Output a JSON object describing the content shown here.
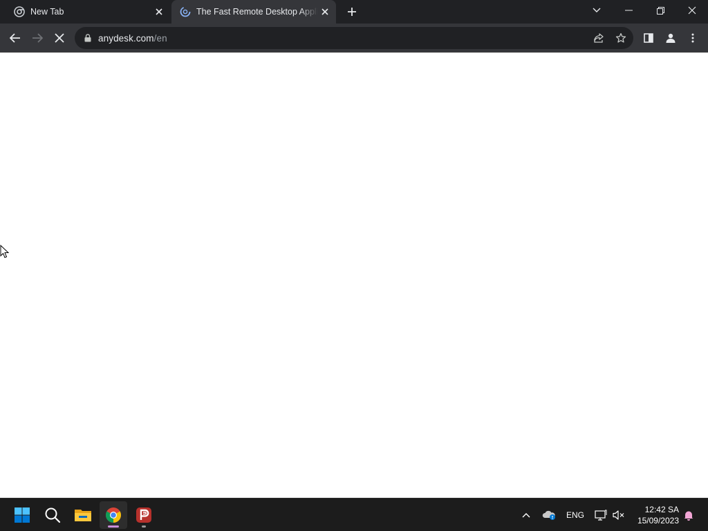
{
  "browser": {
    "tabs": [
      {
        "title": "New Tab",
        "favicon": "chrome-newtab-icon",
        "active": false
      },
      {
        "title": "The Fast Remote Desktop Application",
        "favicon": "loading-globe-icon",
        "active": true
      }
    ],
    "window_controls": [
      "tab-search-icon",
      "minimize-icon",
      "restore-icon",
      "close-icon"
    ]
  },
  "toolbar": {
    "url_host": "anydesk.com",
    "url_path": "/en",
    "buttons": [
      "back-icon",
      "forward-icon",
      "stop-loading-icon",
      "share-icon",
      "bookmark-star-icon",
      "side-panel-icon",
      "profile-icon",
      "menu-icon"
    ]
  },
  "page": {
    "state": "loading",
    "background": "#ffffff"
  },
  "taskbar": {
    "apps": [
      "windows-start-icon",
      "search-icon",
      "file-explorer-icon",
      "chrome-icon",
      "psiphon-icon"
    ],
    "tray": {
      "language": "ENG",
      "icons": [
        "show-hidden-icons-chevron",
        "onedrive-icon",
        "network-icon",
        "volume-muted-icon",
        "notifications-icon"
      ]
    },
    "clock": {
      "time": "12:42 SA",
      "date": "15/09/2023"
    }
  },
  "colors": {
    "tabstrip": "#202124",
    "toolbar": "#35363a",
    "omnibox": "#202124",
    "taskbar": "#1c1c1c",
    "accent_blue": "#0078d4"
  }
}
